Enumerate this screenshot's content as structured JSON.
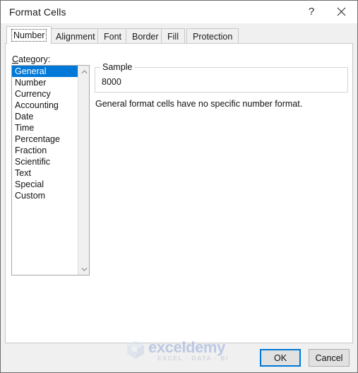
{
  "window": {
    "title": "Format Cells",
    "help_icon": "question-mark-icon",
    "close_icon": "close-icon"
  },
  "tabs": [
    {
      "label": "Number",
      "selected": true
    },
    {
      "label": "Alignment",
      "selected": false
    },
    {
      "label": "Font",
      "selected": false
    },
    {
      "label": "Border",
      "selected": false
    },
    {
      "label": "Fill",
      "selected": false
    },
    {
      "label": "Protection",
      "selected": false
    }
  ],
  "category": {
    "label_accel": "C",
    "label_rest": "ategory:",
    "items": [
      "General",
      "Number",
      "Currency",
      "Accounting",
      "Date",
      "Time",
      "Percentage",
      "Fraction",
      "Scientific",
      "Text",
      "Special",
      "Custom"
    ],
    "selected": "General"
  },
  "sample": {
    "legend": "Sample",
    "value": "8000"
  },
  "description": "General format cells have no specific number format.",
  "footer": {
    "ok_label": "OK",
    "cancel_label": "Cancel"
  },
  "watermark": {
    "name": "exceldemy",
    "tagline": "EXCEL · DATA · BI"
  },
  "colors": {
    "selection_blue": "#0078d7",
    "dialog_bg": "#f0f0f0",
    "panel_bg": "#ffffff",
    "border_gray": "#c8c8c8"
  }
}
